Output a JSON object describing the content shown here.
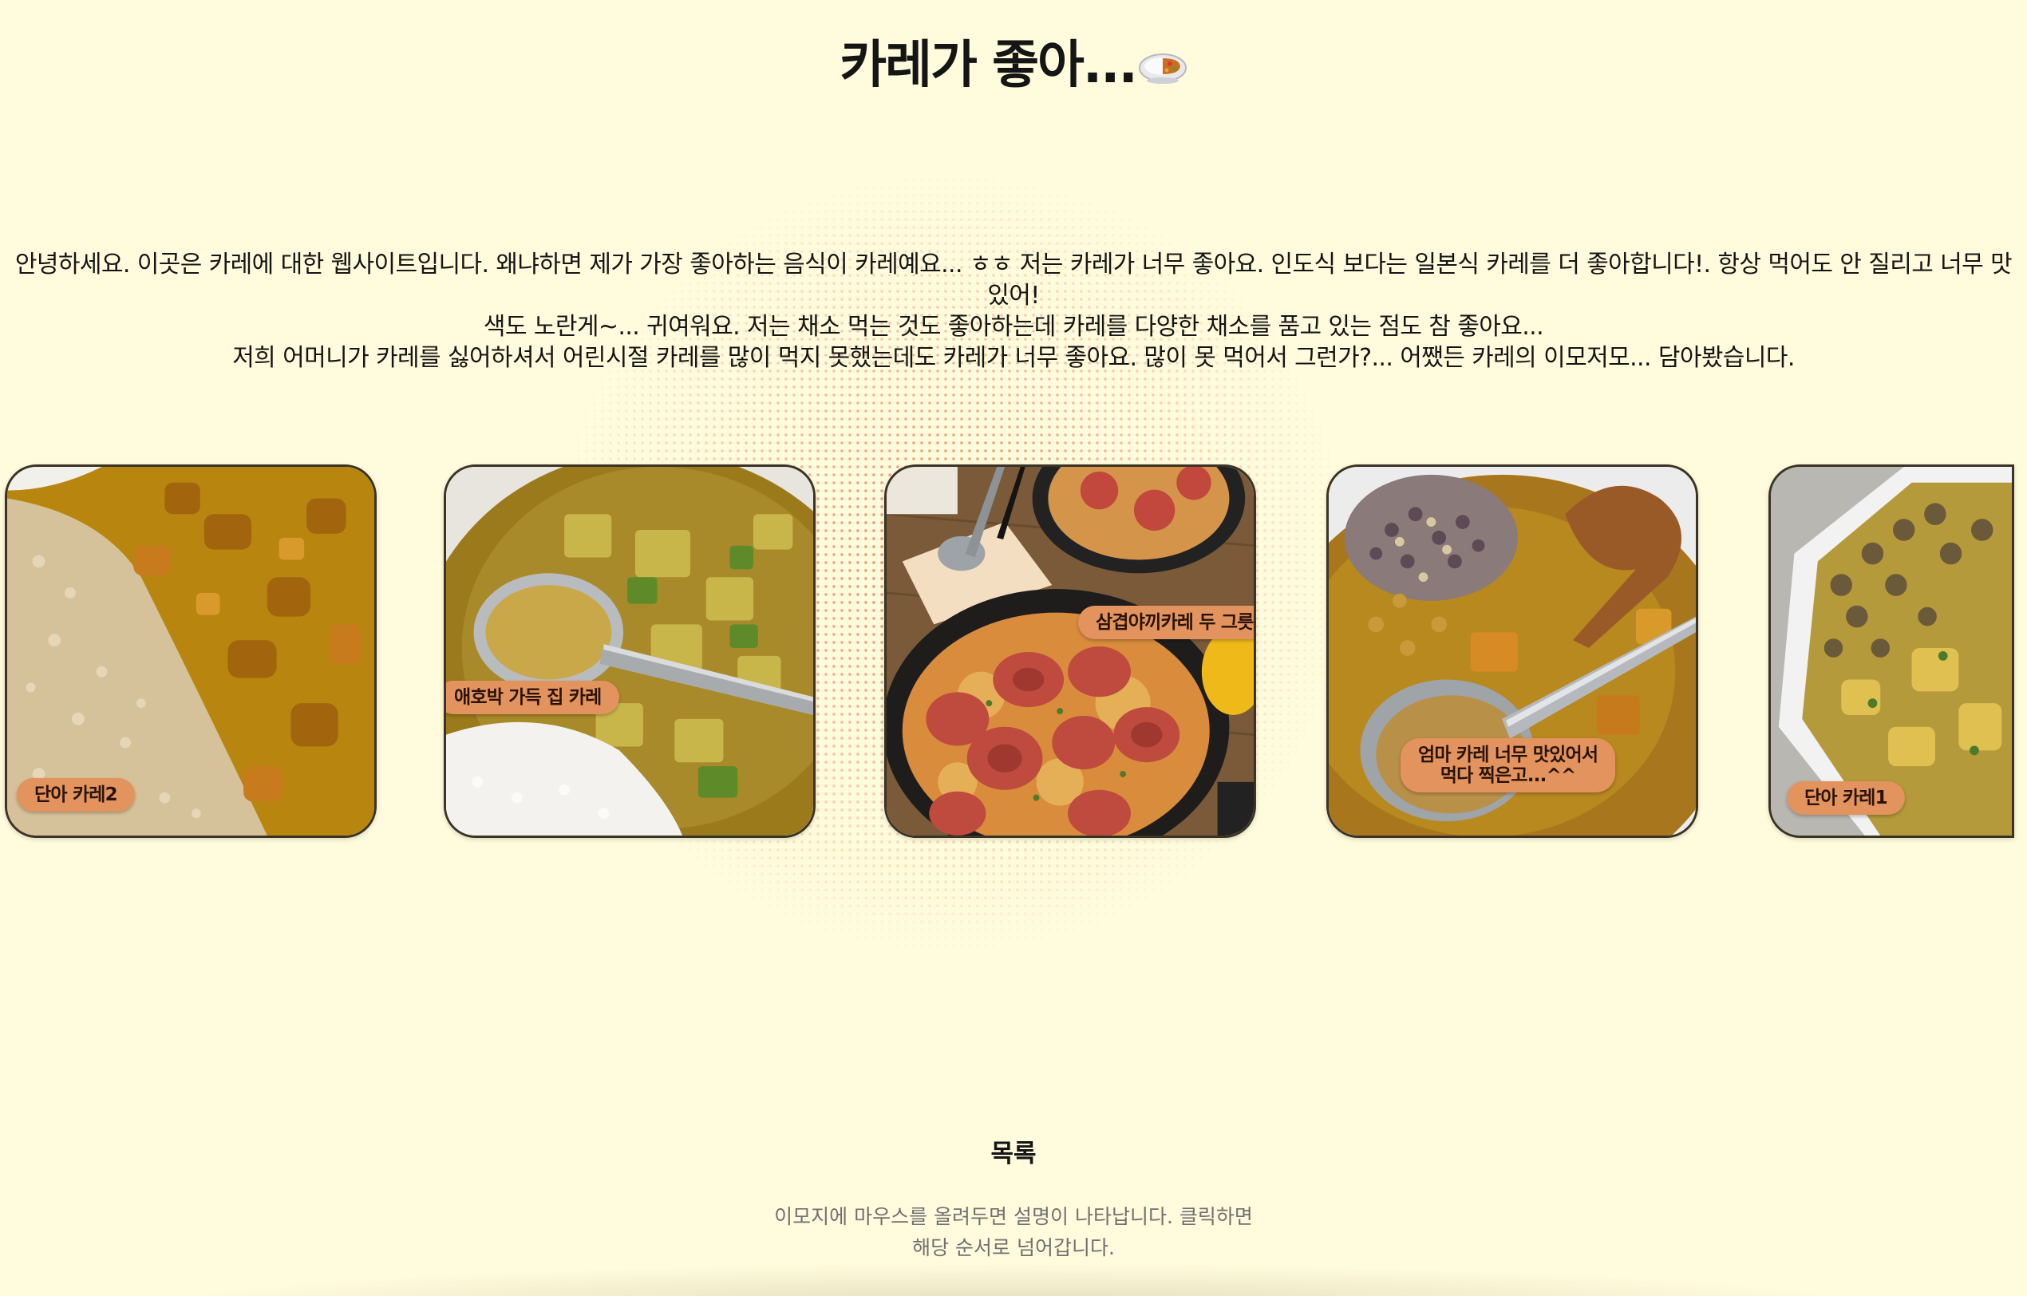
{
  "header": {
    "title": "카레가 좋아...",
    "emoji": "curry-rice-emoji"
  },
  "intro": {
    "lines": [
      "안녕하세요. 이곳은 카레에 대한 웹사이트입니다. 왜냐하면 제가 가장 좋아하는 음식이 카레예요... ㅎㅎ 저는 카레가 너무 좋아요. 인도식 보다는 일본식 카레를 더 좋아합니다!. 항상 먹어도 안 질리고 너무 맛있어!",
      "색도 노란게~... 귀여워요. 저는 채소 먹는 것도 좋아하는데 카레를 다양한 채소를 품고 있는 점도 참 좋아요...",
      "저희 어머니가 카레를 싫어하셔서 어린시절 카레를 많이 먹지 못했는데도 카레가 너무 좋아요. 많이 못 먹어서 그런가?... 어쨌든 카레의 이모저모... 담아봤습니다."
    ]
  },
  "carousel": {
    "cards": [
      {
        "label": "단아 카레2",
        "photo": "brown-rice-chunky-curry"
      },
      {
        "label": "애호박 가득 집 카레",
        "photo": "zucchini-curry-with-spoon"
      },
      {
        "label": "삼겹야끼카레 두 그릇...",
        "photo": "samgyeop-yaki-curry-two-pans"
      },
      {
        "label": "엄마 카레 너무 맛있어서\n먹다 찍은고...^^",
        "photo": "multigrain-rice-curry-wooden-spoon"
      },
      {
        "label": "단아 카레1",
        "photo": "ground-meat-curry-hexagon-bowl"
      }
    ]
  },
  "toc": {
    "heading": "목록",
    "description": "이모지에 마우스를 올려두면 설명이 나타납니다. 클릭하면\n해당 순서로 넘어갑니다."
  },
  "colors": {
    "background": "#fffbdc",
    "label_fill": "#e3935e",
    "dot_accent": "#e47d50",
    "card_border": "#3a3326"
  }
}
